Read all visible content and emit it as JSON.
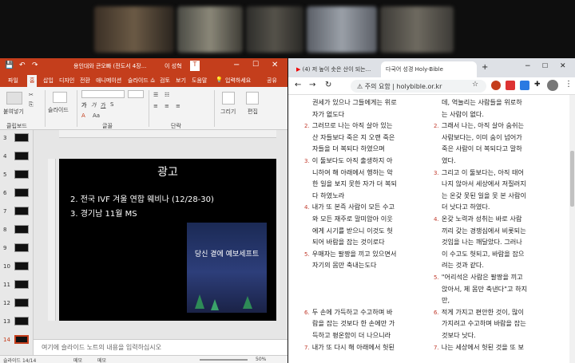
{
  "ppt": {
    "title": "용인대와 큰오빠 (전도서 4장...",
    "user": "이 성혁",
    "tabs": [
      "파일",
      "홈",
      "삽입",
      "디자인",
      "전환",
      "애니메이션",
      "슬라이드 쇼",
      "검토",
      "보기",
      "도움말",
      "입력하세요",
      "공유"
    ],
    "ribbon": {
      "paste": "붙여넣기",
      "slide": "슬라이드",
      "draw": "그리기",
      "edit": "편집",
      "groups": [
        "클립보드",
        "글꼴",
        "단락"
      ]
    },
    "thumb_numbers": [
      "3",
      "4",
      "5",
      "6",
      "7",
      "8",
      "9",
      "10",
      "11",
      "12",
      "13",
      "14"
    ],
    "slide": {
      "title": "광고",
      "line1": "2. 전국 IVF 겨울 연합 웨비나 (12/28-30)",
      "line2": "3. 경기남 11월 MS",
      "poster_text": "당신 곁에 예보세프트"
    },
    "notes_placeholder": "여기에 슬라이드 노트의 내용을 입력하십시오",
    "status": {
      "slide_count": "슬라이드 14/14",
      "notes": "메모",
      "memo": "메모",
      "zoom": "50%"
    }
  },
  "browser": {
    "tab1": "(4) 저 높이 솟은 산이 되는...",
    "tab2": "다국어 성경 Holy-Bible",
    "url_prefix": "주의 요함",
    "url": "holybible.or.kr",
    "left_col": [
      {
        "num": "",
        "text": "권세가 있으나 그들에게는 위로"
      },
      {
        "num": "",
        "text": "자가 없도다"
      },
      {
        "num": "2.",
        "text": "그러므로 나는 아직 살아 있는"
      },
      {
        "num": "",
        "text": "산 자들보다 죽은 지 오랜 죽은"
      },
      {
        "num": "",
        "text": "자들을 더 복되다 하였으며"
      },
      {
        "num": "3.",
        "text": "이 둘보다도 아직 출생하지 아"
      },
      {
        "num": "",
        "text": "니하여 해 아래에서 행하는 악"
      },
      {
        "num": "",
        "text": "한 일을 보지 못한 자가 더 복되"
      },
      {
        "num": "",
        "text": "다 하였노라"
      },
      {
        "num": "4.",
        "text": "내가 또 본즉 사람이 모든 수고"
      },
      {
        "num": "",
        "text": "와 모든 재주로 말미암아 이웃"
      },
      {
        "num": "",
        "text": "에게 시기를 받으니 이것도 헛"
      },
      {
        "num": "",
        "text": "되어 바람을 잡는 것이로다"
      },
      {
        "num": "5.",
        "text": "우매자는 팔짱을 끼고 있으면서"
      },
      {
        "num": "",
        "text": "자기의 몸만 축내는도다"
      },
      {
        "num": "",
        "text": ""
      },
      {
        "num": "",
        "text": ""
      },
      {
        "num": "",
        "text": ""
      },
      {
        "num": "6.",
        "text": "두 손에 가득하고 수고하며 바"
      },
      {
        "num": "",
        "text": "람을 잡는 것보다 한 손에만 가"
      },
      {
        "num": "",
        "text": "득하고 평온함이 더 나으니라"
      },
      {
        "num": "7.",
        "text": "내가 또 다시 해 아래에서 헛된"
      }
    ],
    "right_col": [
      {
        "num": "",
        "text": "데, 억눌리는 사람들을 위로하"
      },
      {
        "num": "",
        "text": "는 사람이 없다."
      },
      {
        "num": "2.",
        "text": "그래서 나는, 아직 살아 숨쉬는"
      },
      {
        "num": "",
        "text": "사람보다는, 이미 숨이 넘어가"
      },
      {
        "num": "",
        "text": "죽은 사람이 더 복되다고 말하"
      },
      {
        "num": "",
        "text": "였다."
      },
      {
        "num": "3.",
        "text": "그리고 이 둘보다는, 아직 태어"
      },
      {
        "num": "",
        "text": "나지 않아서 세상에서 저질러지"
      },
      {
        "num": "",
        "text": "는 온갖 못된 일을 못 본 사람이"
      },
      {
        "num": "",
        "text": "더 낫다고 하였다."
      },
      {
        "num": "4.",
        "text": "온갖 노력과 성취는 바로 사람"
      },
      {
        "num": "",
        "text": "끼리 갖는 경쟁심에서 비롯되는"
      },
      {
        "num": "",
        "text": "것임을 나는 깨달았다. 그러나"
      },
      {
        "num": "",
        "text": "이 수고도 헛되고, 바람을 잡으"
      },
      {
        "num": "",
        "text": "려는 것과 같다."
      },
      {
        "num": "5.",
        "text": "\"어리석은 사람은 팔짱을 끼고"
      },
      {
        "num": "",
        "text": "앉아서, 제 몸만 축낸다\"고 하지"
      },
      {
        "num": "",
        "text": "만,"
      },
      {
        "num": "6.",
        "text": "적게 가지고 편안한 것이, 많이"
      },
      {
        "num": "",
        "text": "가지려고 수고하며 바람을 잡는"
      },
      {
        "num": "",
        "text": "것보다 낫다."
      },
      {
        "num": "7.",
        "text": "나는 세상에서 헛된 것을 또 보"
      }
    ]
  },
  "colors": {
    "ppt_accent": "#c43e1c",
    "verse_num": "#c0392b",
    "link": "#1a3fa0"
  }
}
